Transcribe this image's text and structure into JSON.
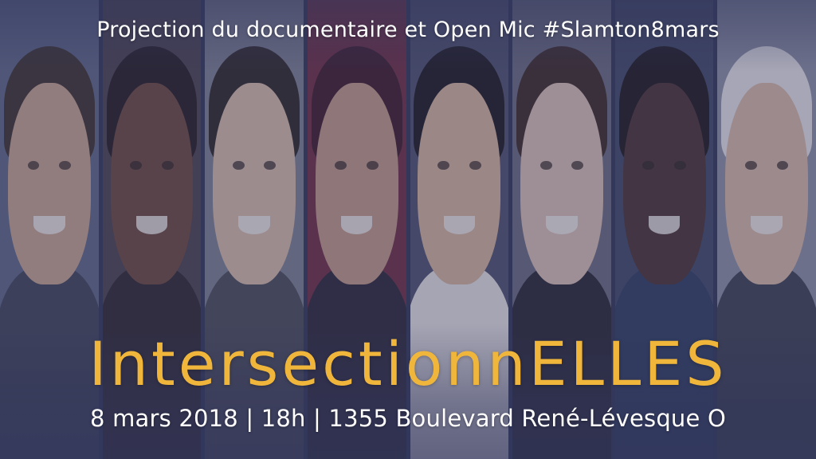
{
  "poster": {
    "subtitle": "Projection du documentaire et Open Mic #Slamton8mars",
    "title": "IntersectionnELLES",
    "details": "8 mars 2018 | 18h | 1355 Boulevard René-Lévesque O"
  },
  "colors": {
    "title": "#f0b63c",
    "text": "#ffffff",
    "overlay": "#3a3e6c"
  },
  "portraits": [
    {
      "name": "portrait-1",
      "bg": "#5d6480",
      "skin": "#c9a48a",
      "hair": "#3a3026",
      "body": "#3e4252"
    },
    {
      "name": "portrait-2",
      "bg": "#4a3f48",
      "skin": "#6b4636",
      "hair": "#22191a",
      "body": "#2c2428"
    },
    {
      "name": "portrait-3",
      "bg": "#7d7f8c",
      "skin": "#d8bba4",
      "hair": "#2d2420",
      "body": "#4a4a52"
    },
    {
      "name": "portrait-4",
      "bg": "#6e2a3a",
      "skin": "#c49880",
      "hair": "#3d1822",
      "body": "#2a2430"
    },
    {
      "name": "portrait-5",
      "bg": "#4c4e66",
      "skin": "#d6b396",
      "hair": "#1a1618",
      "body": "#e8e4e0"
    },
    {
      "name": "portrait-6",
      "bg": "#6a6a7a",
      "skin": "#dbbfae",
      "hair": "#3b2720",
      "body": "#26222a"
    },
    {
      "name": "portrait-7",
      "bg": "#3f4660",
      "skin": "#4a302a",
      "hair": "#1a1414",
      "body": "#2c3a5a"
    },
    {
      "name": "portrait-8",
      "bg": "#8b8e9e",
      "skin": "#d9b8a2",
      "hair": "#e9e6e4",
      "body": "#3b3e4a"
    }
  ]
}
